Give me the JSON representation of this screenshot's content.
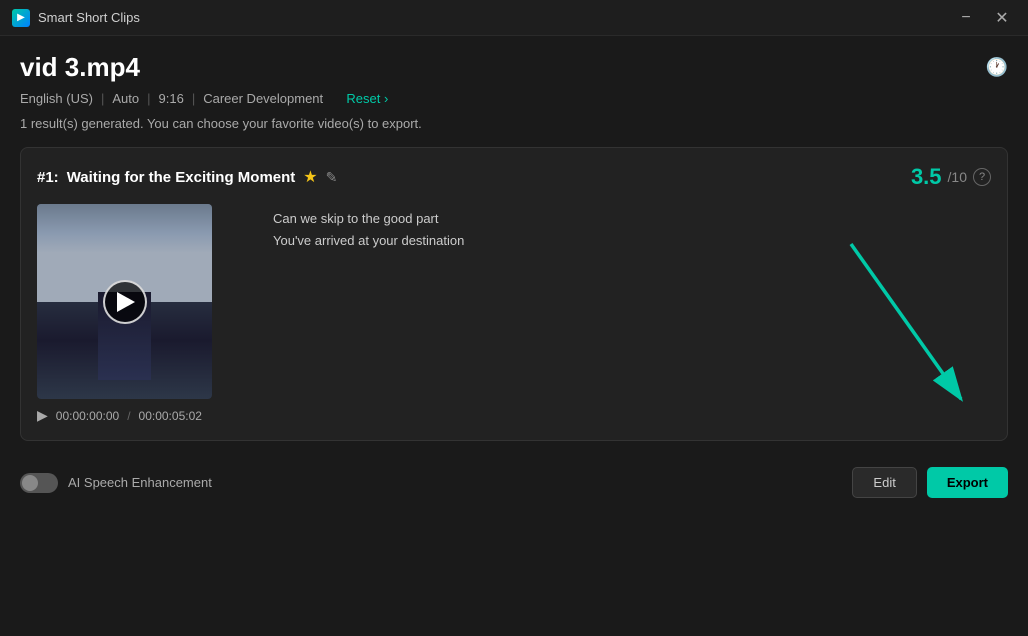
{
  "titleBar": {
    "appName": "Smart Short Clips",
    "minimizeLabel": "−",
    "closeLabel": "✕"
  },
  "header": {
    "fileName": "vid 3.mp4",
    "historyIconLabel": "🕐",
    "meta": {
      "language": "English (US)",
      "mode": "Auto",
      "aspectRatio": "9:16",
      "topic": "Career Development",
      "resetLabel": "Reset ›"
    },
    "resultInfo": "1 result(s) generated. You can choose your favorite video(s) to export."
  },
  "clip": {
    "number": "#1:",
    "name": "Waiting for the Exciting Moment",
    "starIcon": "★",
    "editIconLabel": "✎",
    "score": "3.5",
    "scoreDenom": "/10",
    "infoIconLabel": "?",
    "transcript": {
      "line1": "Can we skip to the good part",
      "line2": "You've arrived at your destination"
    },
    "video": {
      "timeStart": "00:00:00:00",
      "timeSep": "/",
      "timeEnd": "00:00:05:02"
    }
  },
  "bottomBar": {
    "aiLabel": "AI Speech Enhancement",
    "editButton": "Edit",
    "exportButton": "Export"
  }
}
